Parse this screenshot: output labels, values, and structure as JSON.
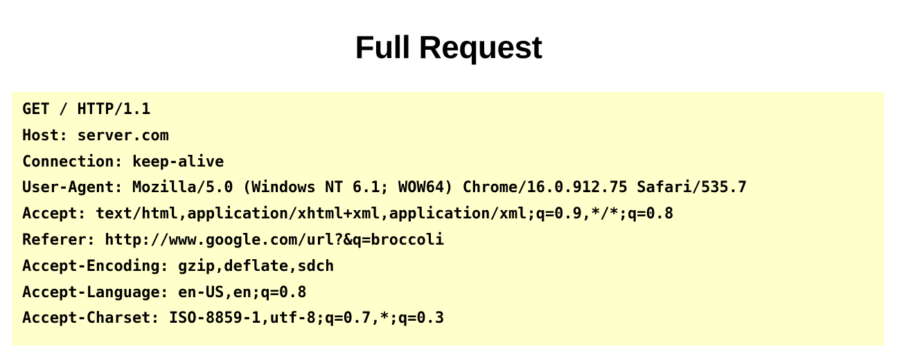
{
  "slide": {
    "title": "Full Request"
  },
  "request": {
    "lines": [
      "GET / HTTP/1.1",
      "Host: server.com",
      "Connection: keep-alive",
      "User-Agent: Mozilla/5.0 (Windows NT 6.1; WOW64) Chrome/16.0.912.75 Safari/535.7",
      "Accept: text/html,application/xhtml+xml,application/xml;q=0.9,*/*;q=0.8",
      "Referer: http://www.google.com/url?&q=broccoli",
      "Accept-Encoding: gzip,deflate,sdch",
      "Accept-Language: en-US,en;q=0.8",
      "Accept-Charset: ISO-8859-1,utf-8;q=0.7,*;q=0.3"
    ]
  },
  "colors": {
    "code_background": "#ffffcc",
    "text": "#000000"
  }
}
